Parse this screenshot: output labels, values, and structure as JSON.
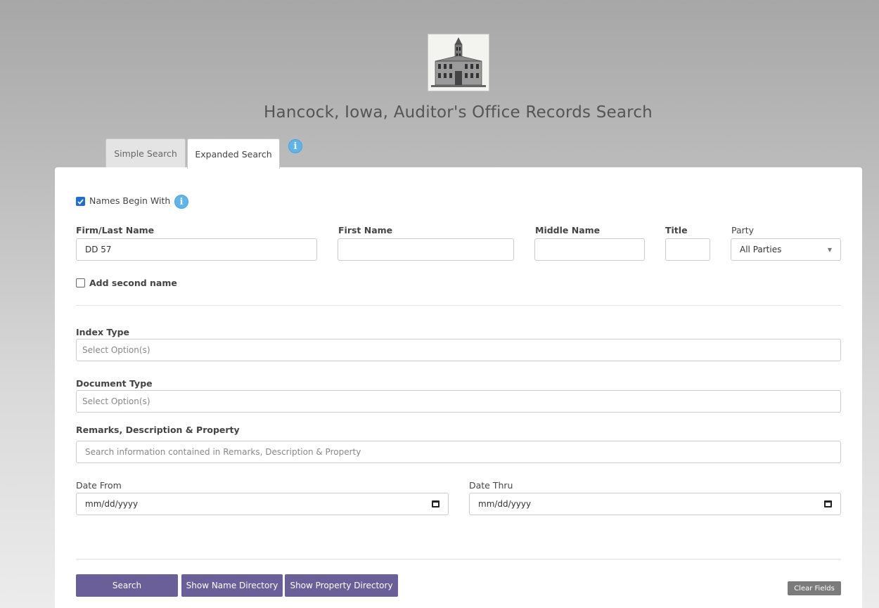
{
  "page": {
    "title": "Hancock, Iowa, Auditor's Office Records Search"
  },
  "tabs": [
    {
      "label": "Simple Search",
      "active": false
    },
    {
      "label": "Expanded Search",
      "active": true
    }
  ],
  "info_icon_glyph": "i",
  "names_begin_with": {
    "label": "Names Begin With",
    "checked": true
  },
  "fields": {
    "last_name": {
      "label": "Firm/Last Name",
      "value": "DD 57"
    },
    "first_name": {
      "label": "First Name",
      "value": ""
    },
    "middle_name": {
      "label": "Middle Name",
      "value": ""
    },
    "title": {
      "label": "Title",
      "value": ""
    },
    "party": {
      "label": "Party",
      "value": "All Parties"
    }
  },
  "add_second_name": {
    "label": "Add second name",
    "checked": false
  },
  "index_type": {
    "label": "Index Type",
    "placeholder": "Select Option(s)"
  },
  "document_type": {
    "label": "Document Type",
    "placeholder": "Select Option(s)"
  },
  "remarks": {
    "label": "Remarks, Description & Property",
    "placeholder": "Search information contained in Remarks, Description & Property"
  },
  "date_from": {
    "label": "Date From",
    "placeholder": "mm/dd/yyyy"
  },
  "date_thru": {
    "label": "Date Thru",
    "placeholder": "mm/dd/yyyy"
  },
  "buttons": {
    "search": "Search",
    "name_directory": "Show Name Directory",
    "property_directory": "Show Property Directory",
    "clear_fields": "Clear Fields"
  },
  "colors": {
    "primary_button": "#6a5f99",
    "info_icon": "#5fb4ec",
    "checkbox": "#1f6fd1",
    "clear_button": "#7b7b7b"
  }
}
